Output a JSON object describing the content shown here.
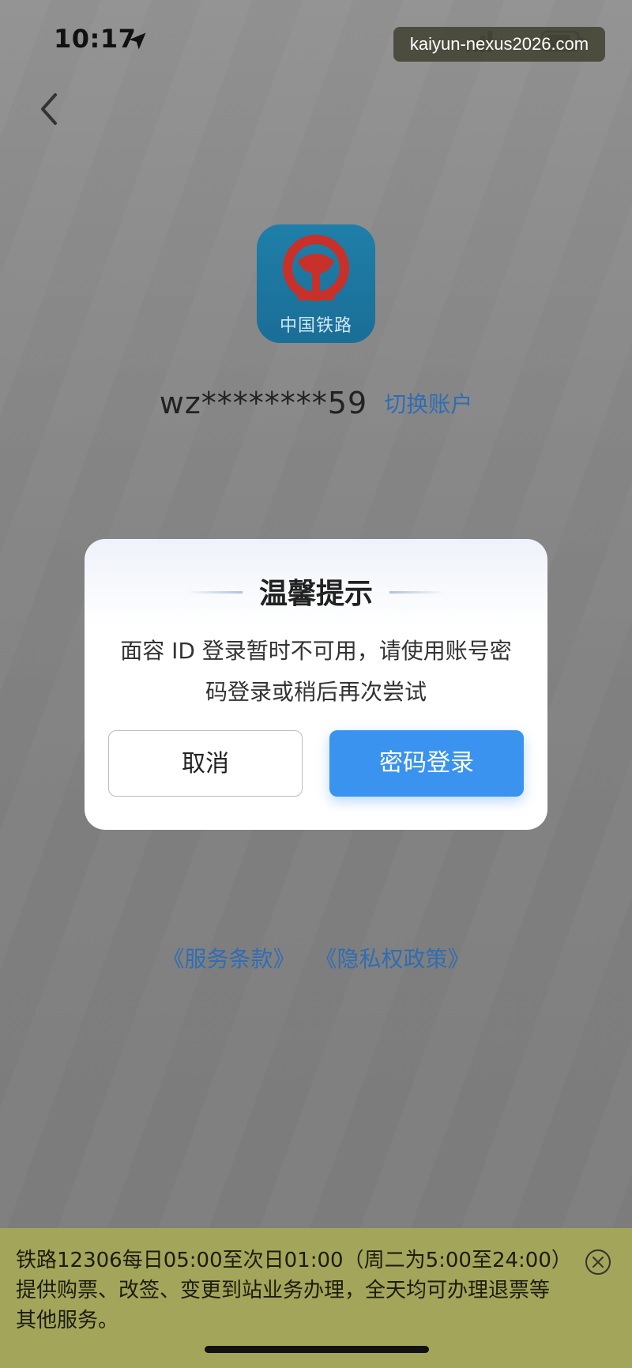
{
  "status_bar": {
    "time": "10:17",
    "location_icon": "location-arrow-icon",
    "signal_icon": "signal-bars-icon",
    "battery_icon": "battery-icon"
  },
  "watermark": {
    "text": "kaiyun-nexus2026.com"
  },
  "nav": {
    "back_icon": "chevron-left-icon"
  },
  "app": {
    "logo_text": "中国铁路",
    "logo_icon": "china-railway-logo",
    "brand_color": "#1f7fa8"
  },
  "account": {
    "name": "wz********59",
    "switch_label": "切换账户"
  },
  "dialog": {
    "title": "温馨提示",
    "message_line1": "面容 ID 登录暂时不可用，请使用账号密",
    "message_line2": "码登录或稍后再次尝试",
    "cancel_label": "取消",
    "confirm_label": "密码登录",
    "accent_color": "#3a93ee"
  },
  "terms": {
    "service_terms": "《服务条款》",
    "privacy_policy": "《隐私权政策》"
  },
  "notice": {
    "line1": "铁路12306每日05:00至次日01:00（周二为5:00至24:00）",
    "line2": "提供购票、改签、变更到站业务办理，全天均可办理退票等",
    "line3": "其他服务。",
    "close_icon": "close-circle-icon"
  }
}
